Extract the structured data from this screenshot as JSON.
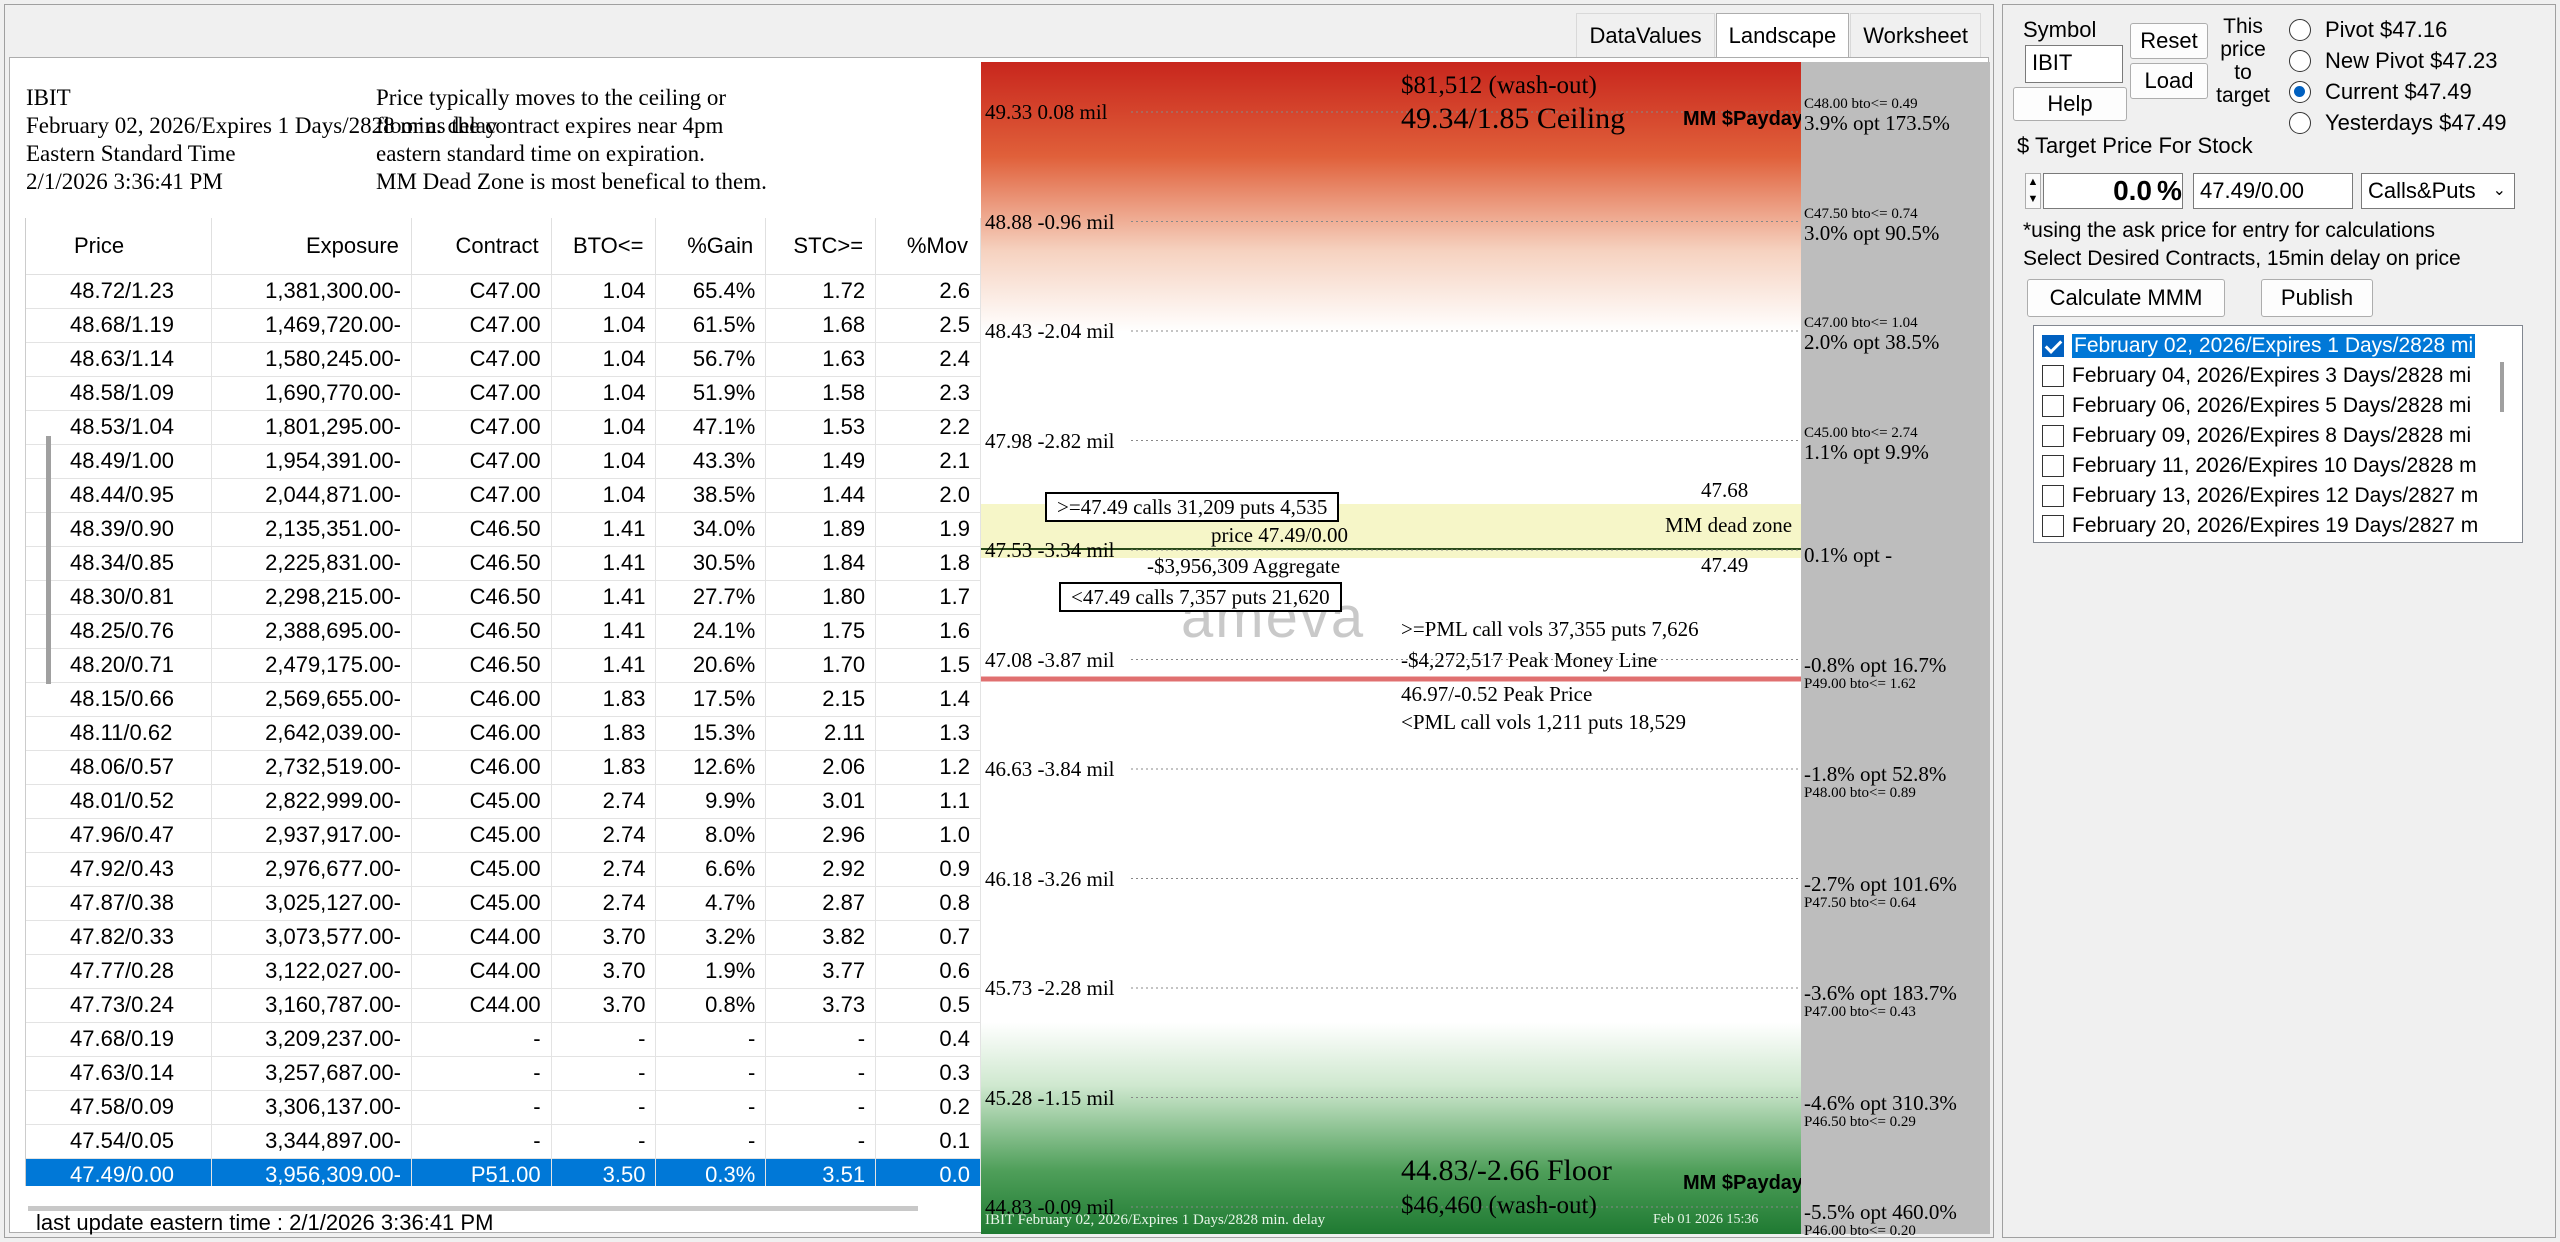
{
  "tabs": [
    "DataValues",
    "Landscape",
    "Worksheet"
  ],
  "info": {
    "left_lines": [
      "IBIT",
      "February 02, 2026/Expires 1 Days/2828 min. delay",
      "Eastern Standard Time",
      "2/1/2026 3:36:41 PM"
    ],
    "right_lines": [
      "Price typically moves to the ceiling or",
      "floor as the contract expires near 4pm",
      "eastern standard time on expiration.",
      "MM Dead Zone is most benefical to them."
    ]
  },
  "table": {
    "columns": [
      "Price",
      "Exposure",
      "Contract",
      "BTO<=",
      "%Gain",
      "STC>=",
      "%Mov"
    ],
    "rows": [
      [
        "48.72/1.23",
        "1,381,300.00-",
        "C47.00",
        "1.04",
        "65.4%",
        "1.72",
        "2.6"
      ],
      [
        "48.68/1.19",
        "1,469,720.00-",
        "C47.00",
        "1.04",
        "61.5%",
        "1.68",
        "2.5"
      ],
      [
        "48.63/1.14",
        "1,580,245.00-",
        "C47.00",
        "1.04",
        "56.7%",
        "1.63",
        "2.4"
      ],
      [
        "48.58/1.09",
        "1,690,770.00-",
        "C47.00",
        "1.04",
        "51.9%",
        "1.58",
        "2.3"
      ],
      [
        "48.53/1.04",
        "1,801,295.00-",
        "C47.00",
        "1.04",
        "47.1%",
        "1.53",
        "2.2"
      ],
      [
        "48.49/1.00",
        "1,954,391.00-",
        "C47.00",
        "1.04",
        "43.3%",
        "1.49",
        "2.1"
      ],
      [
        "48.44/0.95",
        "2,044,871.00-",
        "C47.00",
        "1.04",
        "38.5%",
        "1.44",
        "2.0"
      ],
      [
        "48.39/0.90",
        "2,135,351.00-",
        "C46.50",
        "1.41",
        "34.0%",
        "1.89",
        "1.9"
      ],
      [
        "48.34/0.85",
        "2,225,831.00-",
        "C46.50",
        "1.41",
        "30.5%",
        "1.84",
        "1.8"
      ],
      [
        "48.30/0.81",
        "2,298,215.00-",
        "C46.50",
        "1.41",
        "27.7%",
        "1.80",
        "1.7"
      ],
      [
        "48.25/0.76",
        "2,388,695.00-",
        "C46.50",
        "1.41",
        "24.1%",
        "1.75",
        "1.6"
      ],
      [
        "48.20/0.71",
        "2,479,175.00-",
        "C46.50",
        "1.41",
        "20.6%",
        "1.70",
        "1.5"
      ],
      [
        "48.15/0.66",
        "2,569,655.00-",
        "C46.00",
        "1.83",
        "17.5%",
        "2.15",
        "1.4"
      ],
      [
        "48.11/0.62",
        "2,642,039.00-",
        "C46.00",
        "1.83",
        "15.3%",
        "2.11",
        "1.3"
      ],
      [
        "48.06/0.57",
        "2,732,519.00-",
        "C46.00",
        "1.83",
        "12.6%",
        "2.06",
        "1.2"
      ],
      [
        "48.01/0.52",
        "2,822,999.00-",
        "C45.00",
        "2.74",
        "9.9%",
        "3.01",
        "1.1"
      ],
      [
        "47.96/0.47",
        "2,937,917.00-",
        "C45.00",
        "2.74",
        "8.0%",
        "2.96",
        "1.0"
      ],
      [
        "47.92/0.43",
        "2,976,677.00-",
        "C45.00",
        "2.74",
        "6.6%",
        "2.92",
        "0.9"
      ],
      [
        "47.87/0.38",
        "3,025,127.00-",
        "C45.00",
        "2.74",
        "4.7%",
        "2.87",
        "0.8"
      ],
      [
        "47.82/0.33",
        "3,073,577.00-",
        "C44.00",
        "3.70",
        "3.2%",
        "3.82",
        "0.7"
      ],
      [
        "47.77/0.28",
        "3,122,027.00-",
        "C44.00",
        "3.70",
        "1.9%",
        "3.77",
        "0.6"
      ],
      [
        "47.73/0.24",
        "3,160,787.00-",
        "C44.00",
        "3.70",
        "0.8%",
        "3.73",
        "0.5"
      ],
      [
        "47.68/0.19",
        "3,209,237.00-",
        "-",
        "-",
        "-",
        "-",
        "0.4"
      ],
      [
        "47.63/0.14",
        "3,257,687.00-",
        "-",
        "-",
        "-",
        "-",
        "0.3"
      ],
      [
        "47.58/0.09",
        "3,306,137.00-",
        "-",
        "-",
        "-",
        "-",
        "0.2"
      ],
      [
        "47.54/0.05",
        "3,344,897.00-",
        "-",
        "-",
        "-",
        "-",
        "0.1"
      ],
      [
        "47.49/0.00",
        "3,956,309.00-",
        "P51.00",
        "3.50",
        "0.3%",
        "3.51",
        "0.0"
      ]
    ],
    "selected_row": 26
  },
  "last_update": "last update eastern time : 2/1/2026 3:36:41 PM",
  "landscape": {
    "levels": [
      "49.33 0.08 mil",
      "48.88 -0.96 mil",
      "48.43 -2.04 mil",
      "47.98 -2.82 mil",
      "47.53 -3.34 mil",
      "47.08 -3.87 mil",
      "46.63 -3.84 mil",
      "46.18 -3.26 mil",
      "45.73 -2.28 mil",
      "45.28 -1.15 mil",
      "44.83 -0.09 mil"
    ],
    "ceiling_washout": "$81,512 (wash-out)",
    "ceiling": "49.34/1.85 Ceiling",
    "mm_payday": "MM $Payday",
    "floor": "44.83/-2.66 Floor",
    "floor_washout": "$46,460 (wash-out)",
    "calls_above": ">=47.49 calls 31,209  puts 4,535",
    "calls_below": "<47.49 calls 7,357  puts 21,620",
    "price": "price 47.49/0.00",
    "aggregate": "-$3,956,309 Aggregate",
    "dead_zone": "MM dead zone",
    "dead_top": "47.68",
    "dead_bottom": "47.49",
    "pml_above": ">=PML call vols 37,355  puts 7,626",
    "peak_money_line": "-$4,272,517 Peak Money Line",
    "peak_price": "46.97/-0.52 Peak Price",
    "pml_below": "<PML call vols 1,211  puts 18,529",
    "watermark": "ameva",
    "footer_left": "IBIT   February 02, 2026/Expires 1 Days/2828 min. delay",
    "footer_right": "Feb 01 2026 15:36",
    "options": [
      {
        "pct": "3.9% opt 173.5%",
        "bto": "C48.00 bto<= 0.49",
        "bto_first": true
      },
      {
        "pct": "3.0% opt 90.5%",
        "bto": "C47.50 bto<= 0.74",
        "bto_first": true
      },
      {
        "pct": "2.0% opt 38.5%",
        "bto": "C47.00 bto<= 1.04",
        "bto_first": true
      },
      {
        "pct": "1.1% opt 9.9%",
        "bto": "C45.00 bto<= 2.74",
        "bto_first": true
      },
      {
        "pct": "0.1% opt -",
        "bto": "",
        "bto_first": false
      },
      {
        "pct": "-0.8% opt 16.7%",
        "bto": "P49.00 bto<= 1.62",
        "bto_first": false
      },
      {
        "pct": "-1.8% opt 52.8%",
        "bto": "P48.00 bto<= 0.89",
        "bto_first": false
      },
      {
        "pct": "-2.7% opt 101.6%",
        "bto": "P47.50 bto<= 0.64",
        "bto_first": false
      },
      {
        "pct": "-3.6% opt 183.7%",
        "bto": "P47.00 bto<= 0.43",
        "bto_first": false
      },
      {
        "pct": "-4.6% opt 310.3%",
        "bto": "P46.50 bto<= 0.29",
        "bto_first": false
      },
      {
        "pct": "-5.5% opt 460.0%",
        "bto": "P46.00 bto<= 0.20",
        "bto_first": false
      }
    ]
  },
  "panel": {
    "symbol_label": "Symbol",
    "symbol_value": "IBIT",
    "reset": "Reset",
    "load": "Load",
    "help": "Help",
    "this_price_label": [
      "This",
      "price",
      "to",
      "target"
    ],
    "radios": [
      "Pivot $47.16",
      "New Pivot $47.23",
      "Current $47.49",
      "Yesterdays $47.49"
    ],
    "radio_selected": 2,
    "target_label": "$ Target Price For Stock",
    "percent_value": "0.0",
    "percent_sign": "%",
    "price_value": "47.49/0.00",
    "mode": "Calls&Puts",
    "note1": "*using the ask price for entry for calculations",
    "note2": "Select Desired Contracts, 15min delay on price",
    "calc": "Calculate MMM",
    "publish": "Publish",
    "contracts": [
      "February 02, 2026/Expires 1 Days/2828 mi",
      "February 04, 2026/Expires 3 Days/2828 mi",
      "February 06, 2026/Expires 5 Days/2828 mi",
      "February 09, 2026/Expires 8 Days/2828 mi",
      "February 11, 2026/Expires 10 Days/2828 m",
      "February 13, 2026/Expires 12 Days/2827 m",
      "February 20, 2026/Expires 19 Days/2827 m"
    ],
    "contract_checked": 0
  },
  "colors": {
    "selected": "#0078d7",
    "ceiling": "#c8261d",
    "floor": "#1f7a32",
    "dead_zone": "#f6f6c8",
    "pml_line": "#e07070"
  }
}
